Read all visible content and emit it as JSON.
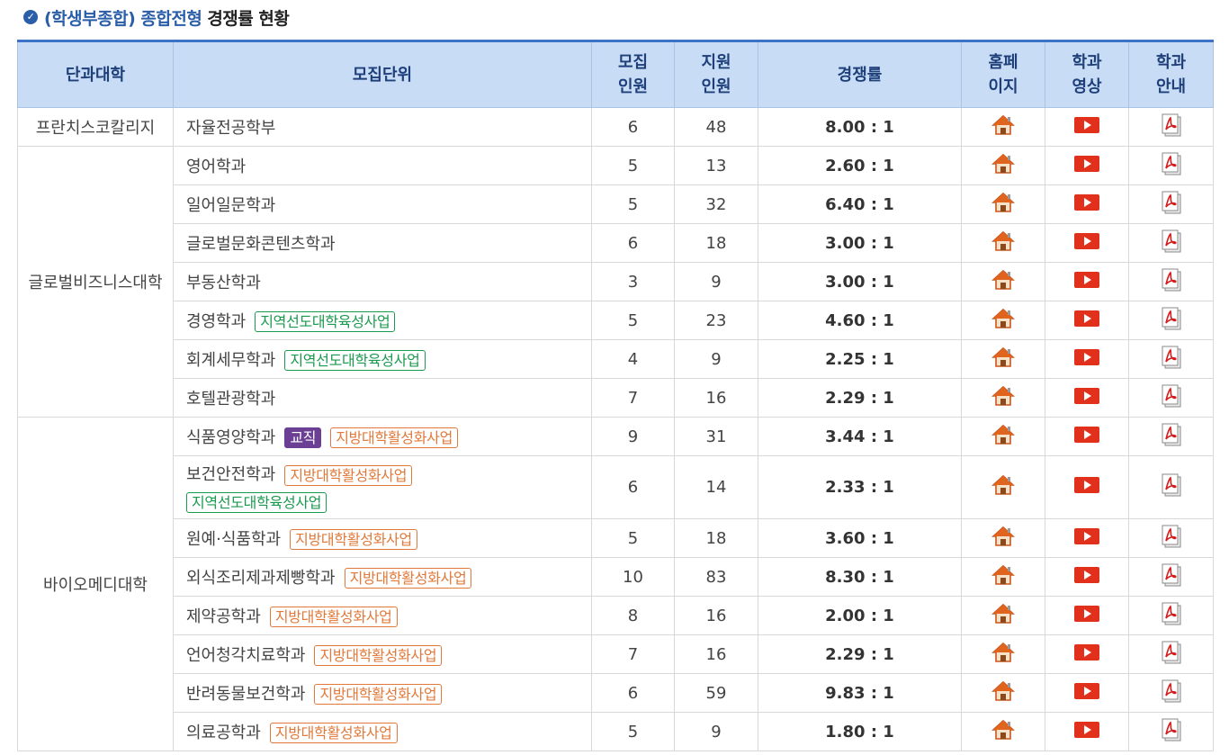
{
  "heading": {
    "icon": "check-circle-icon",
    "highlight": "(학생부종합) 종합전형",
    "rest": "경쟁률 현황"
  },
  "colors": {
    "accent": "#3c73c4",
    "header_bg": "#c8ddf5",
    "green": "#1a9a4e",
    "orange": "#e0793a",
    "purple": "#6b3f94"
  },
  "table": {
    "headers": {
      "college": "단과대학",
      "unit": "모집단위",
      "quota_1": "모집",
      "quota_2": "인원",
      "applicants_1": "지원",
      "applicants_2": "인원",
      "rate": "경쟁률",
      "home_1": "홈페",
      "home_2": "이지",
      "video_1": "학과",
      "video_2": "영상",
      "guide_1": "학과",
      "guide_2": "안내"
    },
    "colleges": [
      "프란치스코칼리지",
      "글로벌비즈니스대학",
      "바이오메디대학"
    ],
    "rows": [
      {
        "unit": "자율전공학부",
        "quota": "6",
        "applicants": "48",
        "rate": "8.00 : 1"
      },
      {
        "unit": "영어학과",
        "quota": "5",
        "applicants": "13",
        "rate": "2.60 : 1"
      },
      {
        "unit": "일어일문학과",
        "quota": "5",
        "applicants": "32",
        "rate": "6.40 : 1"
      },
      {
        "unit": "글로벌문화콘텐츠학과",
        "quota": "6",
        "applicants": "18",
        "rate": "3.00 : 1"
      },
      {
        "unit": "부동산학과",
        "quota": "3",
        "applicants": "9",
        "rate": "3.00 : 1"
      },
      {
        "unit": "경영학과",
        "quota": "5",
        "applicants": "23",
        "rate": "4.60 : 1",
        "badge": "지역선도대학육성사업"
      },
      {
        "unit": "회계세무학과",
        "quota": "4",
        "applicants": "9",
        "rate": "2.25 : 1",
        "badge": "지역선도대학육성사업"
      },
      {
        "unit": "호텔관광학과",
        "quota": "7",
        "applicants": "16",
        "rate": "2.29 : 1"
      },
      {
        "unit": "식품영양학과",
        "quota": "9",
        "applicants": "31",
        "rate": "3.44 : 1",
        "badge_purple": "교직",
        "badge": "지방대학활성화사업"
      },
      {
        "unit": "보건안전학과",
        "quota": "6",
        "applicants": "14",
        "rate": "2.33 : 1",
        "badge": "지방대학활성화사업",
        "badge2": "지역선도대학육성사업"
      },
      {
        "unit": "원예·식품학과",
        "quota": "5",
        "applicants": "18",
        "rate": "3.60 : 1",
        "badge": "지방대학활성화사업"
      },
      {
        "unit": "외식조리제과제빵학과",
        "quota": "10",
        "applicants": "83",
        "rate": "8.30 : 1",
        "badge": "지방대학활성화사업"
      },
      {
        "unit": "제약공학과",
        "quota": "8",
        "applicants": "16",
        "rate": "2.00 : 1",
        "badge": "지방대학활성화사업"
      },
      {
        "unit": "언어청각치료학과",
        "quota": "7",
        "applicants": "16",
        "rate": "2.29 : 1",
        "badge": "지방대학활성화사업"
      },
      {
        "unit": "반려동물보건학과",
        "quota": "6",
        "applicants": "59",
        "rate": "9.83 : 1",
        "badge": "지방대학활성화사업"
      },
      {
        "unit": "의료공학과",
        "quota": "5",
        "applicants": "9",
        "rate": "1.80 : 1",
        "badge": "지방대학활성화사업"
      }
    ],
    "icons": {
      "home": "home-icon",
      "video": "video-play-icon",
      "guide": "pdf-file-icon"
    }
  }
}
